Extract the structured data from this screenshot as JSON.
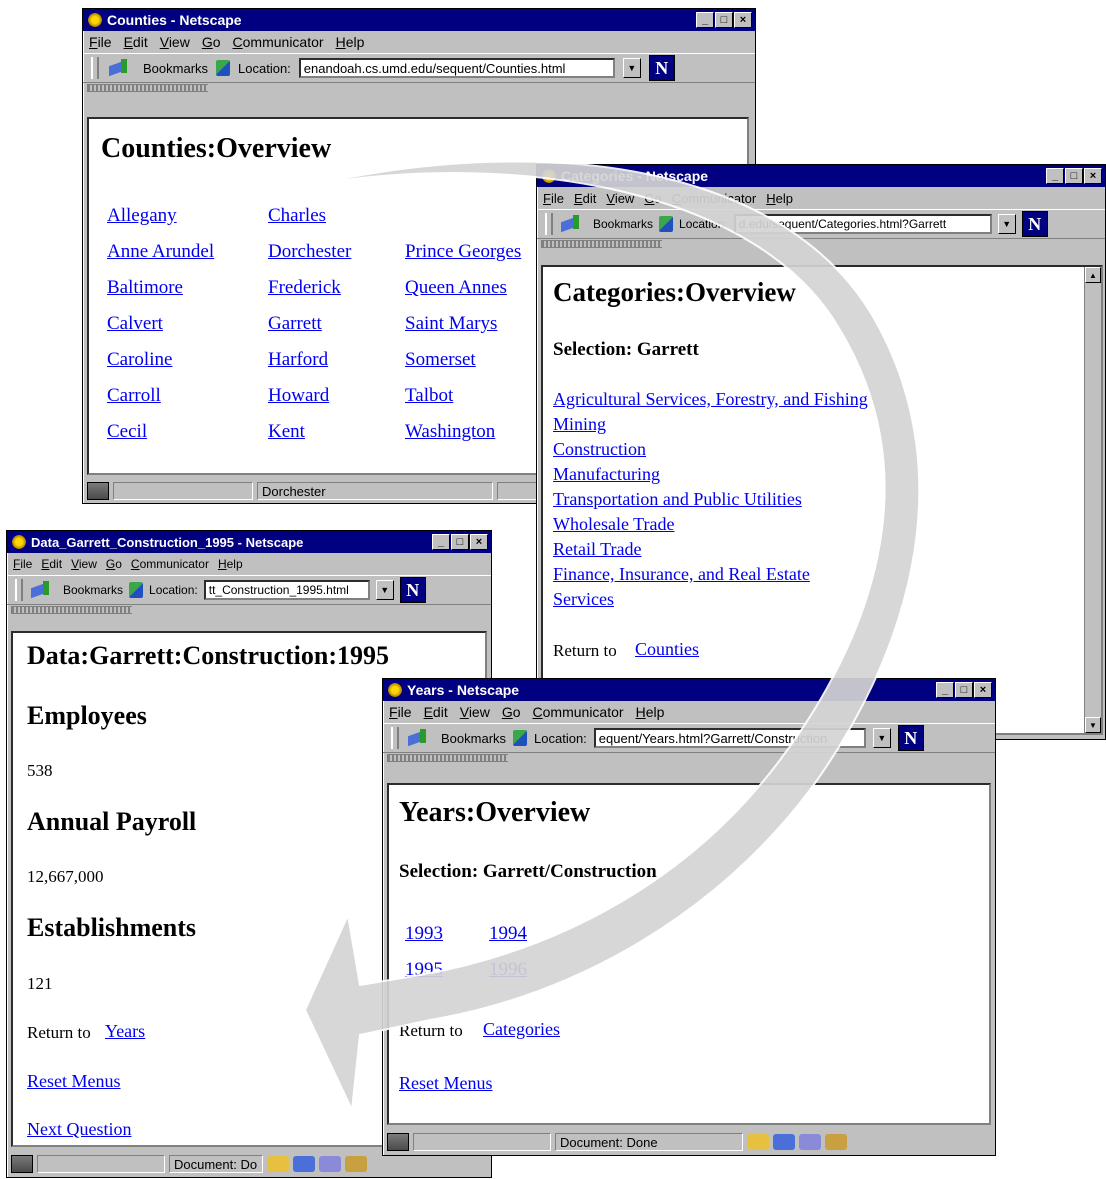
{
  "counties_window": {
    "title": "Counties - Netscape",
    "menu": [
      "File",
      "Edit",
      "View",
      "Go",
      "Communicator",
      "Help"
    ],
    "bookmarks_label": "Bookmarks",
    "location_label": "Location:",
    "location_url": "enandoah.cs.umd.edu/sequent/Counties.html",
    "heading": "Counties:Overview",
    "links_col1": [
      "Allegany",
      "Anne Arundel",
      "Baltimore",
      "Calvert",
      "Caroline",
      "Carroll",
      "Cecil"
    ],
    "links_col2": [
      "Charles",
      "Dorchester",
      "Frederick",
      "Garrett",
      "Harford",
      "Howard",
      "Kent"
    ],
    "links_col3": [
      "",
      "Prince Georges",
      "Queen Annes",
      "Saint Marys",
      "Somerset",
      "Talbot",
      "Washington"
    ],
    "status": "Dorchester"
  },
  "categories_window": {
    "title": "Categories - Netscape",
    "menu": [
      "File",
      "Edit",
      "View",
      "Go",
      "Communicator",
      "Help"
    ],
    "bookmarks_label": "Bookmarks",
    "location_label": "Location:",
    "location_url": "d.edu/sequent/Categories.html?Garrett",
    "heading": "Categories:Overview",
    "selection": "Selection: Garrett",
    "links": [
      "Agricultural Services, Forestry, and Fishing",
      "Mining",
      "Construction",
      "Manufacturing",
      "Transportation and Public Utilities",
      "Wholesale Trade",
      "Retail Trade",
      "Finance, Insurance, and Real Estate",
      "Services"
    ],
    "return_text": "Return to",
    "return_link": "Counties"
  },
  "data_window": {
    "title": "Data_Garrett_Construction_1995 - Netscape",
    "menu": [
      "File",
      "Edit",
      "View",
      "Go",
      "Communicator",
      "Help"
    ],
    "bookmarks_label": "Bookmarks",
    "location_label": "Location:",
    "location_url": "tt_Construction_1995.html",
    "heading": "Data:Garrett:Construction:1995",
    "employees_label": "Employees",
    "employees_value": "538",
    "payroll_label": "Annual Payroll",
    "payroll_value": "12,667,000",
    "establishments_label": "Establishments",
    "establishments_value": "121",
    "return_text": "Return to",
    "return_link": "Years",
    "reset_link": "Reset Menus",
    "next_link": "Next Question",
    "status": "Document: Do"
  },
  "years_window": {
    "title": "Years - Netscape",
    "menu": [
      "File",
      "Edit",
      "View",
      "Go",
      "Communicator",
      "Help"
    ],
    "bookmarks_label": "Bookmarks",
    "location_label": "Location:",
    "location_url": "equent/Years.html?Garrett/Construction",
    "heading": "Years:Overview",
    "selection": "Selection: Garrett/Construction",
    "years": [
      "1993",
      "1994",
      "1995",
      "1996"
    ],
    "return_text": "Return to",
    "return_link": "Categories",
    "reset_link": "Reset Menus",
    "status": "Document: Done"
  },
  "colors": {
    "titlebar": "#000080",
    "link": "#0000ee",
    "chrome": "#c0c0c0",
    "arrow": "#d4d4d4"
  }
}
